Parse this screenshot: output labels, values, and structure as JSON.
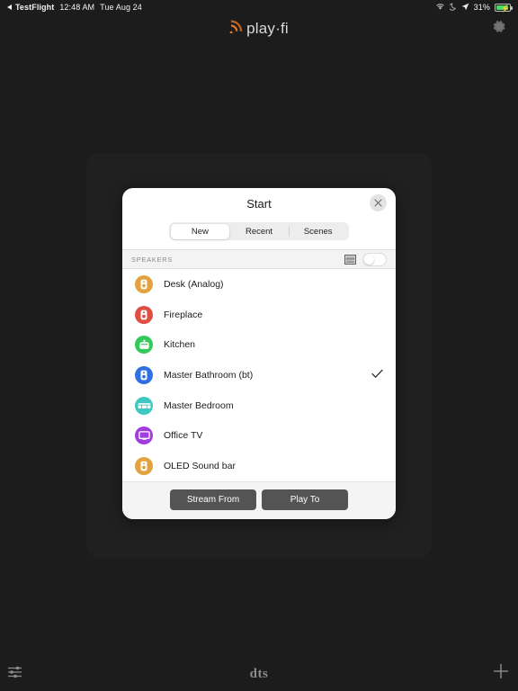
{
  "status_bar": {
    "back_app": "TestFlight",
    "back_icon": "back-triangle-icon",
    "time": "12:48 AM",
    "date": "Tue Aug 24",
    "wifi_icon": "wifi-icon",
    "dnd_icon": "moon-icon",
    "location_icon": "location-arrow-icon",
    "battery_percent": "31%",
    "battery_icon": "battery-charging-icon",
    "battery_color": "#4cd964"
  },
  "top_bar": {
    "logo_text": "play·fi",
    "logo_icon": "playfi-waves-icon",
    "logo_accent": "#e0762a",
    "settings_icon": "gear-icon"
  },
  "modal": {
    "title": "Start",
    "close_icon": "close-icon",
    "tabs": [
      {
        "label": "New",
        "active": true
      },
      {
        "label": "Recent",
        "active": false
      },
      {
        "label": "Scenes",
        "active": false
      }
    ],
    "section": {
      "label": "SPEAKERS",
      "grid_icon": "speaker-grid-icon",
      "toggle_name": "speakers-toggle",
      "toggle_on": false
    },
    "speakers": [
      {
        "name": "Desk (Analog)",
        "color": "#e2a33f",
        "icon": "speaker-icon",
        "selected": false
      },
      {
        "name": "Fireplace",
        "color": "#e04d42",
        "icon": "speaker-icon",
        "selected": false
      },
      {
        "name": "Kitchen",
        "color": "#35c85a",
        "icon": "boombox-icon",
        "selected": false
      },
      {
        "name": "Master Bathroom (bt)",
        "color": "#2f6fe0",
        "icon": "speaker-icon",
        "selected": true
      },
      {
        "name": "Master Bedroom",
        "color": "#3ec8c0",
        "icon": "soundbar-icon",
        "selected": false
      },
      {
        "name": "Office TV",
        "color": "#a13de0",
        "icon": "tv-icon",
        "selected": false
      },
      {
        "name": "OLED Sound bar",
        "color": "#e2a33f",
        "icon": "speaker-icon",
        "selected": false
      }
    ],
    "check_icon": "checkmark-icon",
    "buttons": [
      {
        "label": "Stream From",
        "name": "stream-from-button"
      },
      {
        "label": "Play To",
        "name": "play-to-button"
      }
    ]
  },
  "bottom_bar": {
    "eq_icon": "equalizer-icon",
    "brand": "dts",
    "add_icon": "plus-icon"
  }
}
